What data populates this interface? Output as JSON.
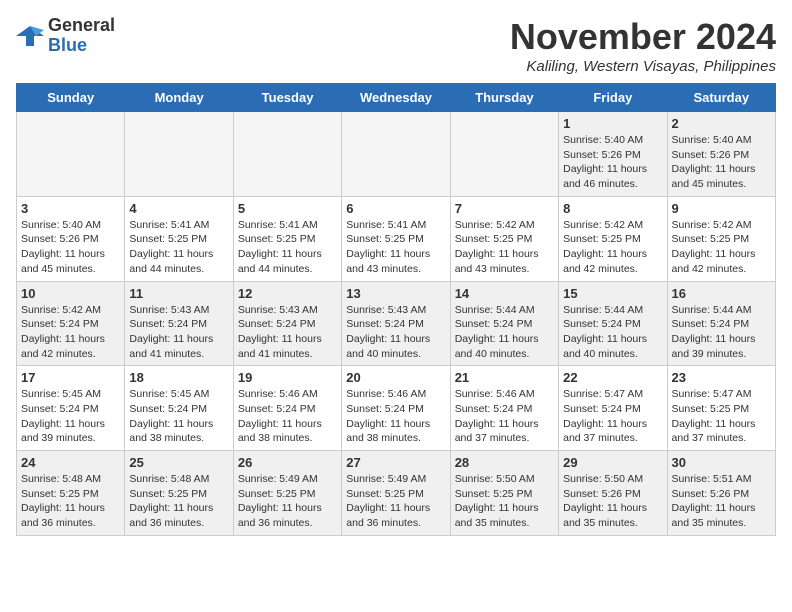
{
  "header": {
    "logo_general": "General",
    "logo_blue": "Blue",
    "month_title": "November 2024",
    "location": "Kaliling, Western Visayas, Philippines"
  },
  "weekdays": [
    "Sunday",
    "Monday",
    "Tuesday",
    "Wednesday",
    "Thursday",
    "Friday",
    "Saturday"
  ],
  "weeks": [
    [
      {
        "day": "",
        "info": "",
        "empty": true
      },
      {
        "day": "",
        "info": "",
        "empty": true
      },
      {
        "day": "",
        "info": "",
        "empty": true
      },
      {
        "day": "",
        "info": "",
        "empty": true
      },
      {
        "day": "",
        "info": "",
        "empty": true
      },
      {
        "day": "1",
        "info": "Sunrise: 5:40 AM\nSunset: 5:26 PM\nDaylight: 11 hours\nand 46 minutes.",
        "empty": false
      },
      {
        "day": "2",
        "info": "Sunrise: 5:40 AM\nSunset: 5:26 PM\nDaylight: 11 hours\nand 45 minutes.",
        "empty": false
      }
    ],
    [
      {
        "day": "3",
        "info": "Sunrise: 5:40 AM\nSunset: 5:26 PM\nDaylight: 11 hours\nand 45 minutes.",
        "empty": false
      },
      {
        "day": "4",
        "info": "Sunrise: 5:41 AM\nSunset: 5:25 PM\nDaylight: 11 hours\nand 44 minutes.",
        "empty": false
      },
      {
        "day": "5",
        "info": "Sunrise: 5:41 AM\nSunset: 5:25 PM\nDaylight: 11 hours\nand 44 minutes.",
        "empty": false
      },
      {
        "day": "6",
        "info": "Sunrise: 5:41 AM\nSunset: 5:25 PM\nDaylight: 11 hours\nand 43 minutes.",
        "empty": false
      },
      {
        "day": "7",
        "info": "Sunrise: 5:42 AM\nSunset: 5:25 PM\nDaylight: 11 hours\nand 43 minutes.",
        "empty": false
      },
      {
        "day": "8",
        "info": "Sunrise: 5:42 AM\nSunset: 5:25 PM\nDaylight: 11 hours\nand 42 minutes.",
        "empty": false
      },
      {
        "day": "9",
        "info": "Sunrise: 5:42 AM\nSunset: 5:25 PM\nDaylight: 11 hours\nand 42 minutes.",
        "empty": false
      }
    ],
    [
      {
        "day": "10",
        "info": "Sunrise: 5:42 AM\nSunset: 5:24 PM\nDaylight: 11 hours\nand 42 minutes.",
        "empty": false
      },
      {
        "day": "11",
        "info": "Sunrise: 5:43 AM\nSunset: 5:24 PM\nDaylight: 11 hours\nand 41 minutes.",
        "empty": false
      },
      {
        "day": "12",
        "info": "Sunrise: 5:43 AM\nSunset: 5:24 PM\nDaylight: 11 hours\nand 41 minutes.",
        "empty": false
      },
      {
        "day": "13",
        "info": "Sunrise: 5:43 AM\nSunset: 5:24 PM\nDaylight: 11 hours\nand 40 minutes.",
        "empty": false
      },
      {
        "day": "14",
        "info": "Sunrise: 5:44 AM\nSunset: 5:24 PM\nDaylight: 11 hours\nand 40 minutes.",
        "empty": false
      },
      {
        "day": "15",
        "info": "Sunrise: 5:44 AM\nSunset: 5:24 PM\nDaylight: 11 hours\nand 40 minutes.",
        "empty": false
      },
      {
        "day": "16",
        "info": "Sunrise: 5:44 AM\nSunset: 5:24 PM\nDaylight: 11 hours\nand 39 minutes.",
        "empty": false
      }
    ],
    [
      {
        "day": "17",
        "info": "Sunrise: 5:45 AM\nSunset: 5:24 PM\nDaylight: 11 hours\nand 39 minutes.",
        "empty": false
      },
      {
        "day": "18",
        "info": "Sunrise: 5:45 AM\nSunset: 5:24 PM\nDaylight: 11 hours\nand 38 minutes.",
        "empty": false
      },
      {
        "day": "19",
        "info": "Sunrise: 5:46 AM\nSunset: 5:24 PM\nDaylight: 11 hours\nand 38 minutes.",
        "empty": false
      },
      {
        "day": "20",
        "info": "Sunrise: 5:46 AM\nSunset: 5:24 PM\nDaylight: 11 hours\nand 38 minutes.",
        "empty": false
      },
      {
        "day": "21",
        "info": "Sunrise: 5:46 AM\nSunset: 5:24 PM\nDaylight: 11 hours\nand 37 minutes.",
        "empty": false
      },
      {
        "day": "22",
        "info": "Sunrise: 5:47 AM\nSunset: 5:24 PM\nDaylight: 11 hours\nand 37 minutes.",
        "empty": false
      },
      {
        "day": "23",
        "info": "Sunrise: 5:47 AM\nSunset: 5:25 PM\nDaylight: 11 hours\nand 37 minutes.",
        "empty": false
      }
    ],
    [
      {
        "day": "24",
        "info": "Sunrise: 5:48 AM\nSunset: 5:25 PM\nDaylight: 11 hours\nand 36 minutes.",
        "empty": false
      },
      {
        "day": "25",
        "info": "Sunrise: 5:48 AM\nSunset: 5:25 PM\nDaylight: 11 hours\nand 36 minutes.",
        "empty": false
      },
      {
        "day": "26",
        "info": "Sunrise: 5:49 AM\nSunset: 5:25 PM\nDaylight: 11 hours\nand 36 minutes.",
        "empty": false
      },
      {
        "day": "27",
        "info": "Sunrise: 5:49 AM\nSunset: 5:25 PM\nDaylight: 11 hours\nand 36 minutes.",
        "empty": false
      },
      {
        "day": "28",
        "info": "Sunrise: 5:50 AM\nSunset: 5:25 PM\nDaylight: 11 hours\nand 35 minutes.",
        "empty": false
      },
      {
        "day": "29",
        "info": "Sunrise: 5:50 AM\nSunset: 5:26 PM\nDaylight: 11 hours\nand 35 minutes.",
        "empty": false
      },
      {
        "day": "30",
        "info": "Sunrise: 5:51 AM\nSunset: 5:26 PM\nDaylight: 11 hours\nand 35 minutes.",
        "empty": false
      }
    ]
  ]
}
